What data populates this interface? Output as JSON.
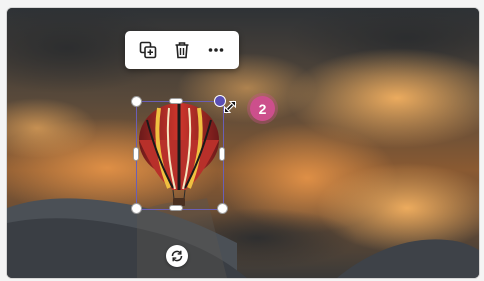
{
  "toolbar": {
    "duplicate_icon": "duplicate-icon",
    "delete_icon": "trash-icon",
    "more_icon": "more-dots-icon"
  },
  "canvas": {
    "background_image": "sunset-clouds-over-mountains",
    "selected_element": "hot-air-balloon-image"
  },
  "step_badge": {
    "label": "2",
    "color": "#cc4f8c"
  },
  "selection": {
    "accent_color": "#6a5fb5"
  },
  "rotate_button": {
    "icon": "rotate-icon"
  }
}
